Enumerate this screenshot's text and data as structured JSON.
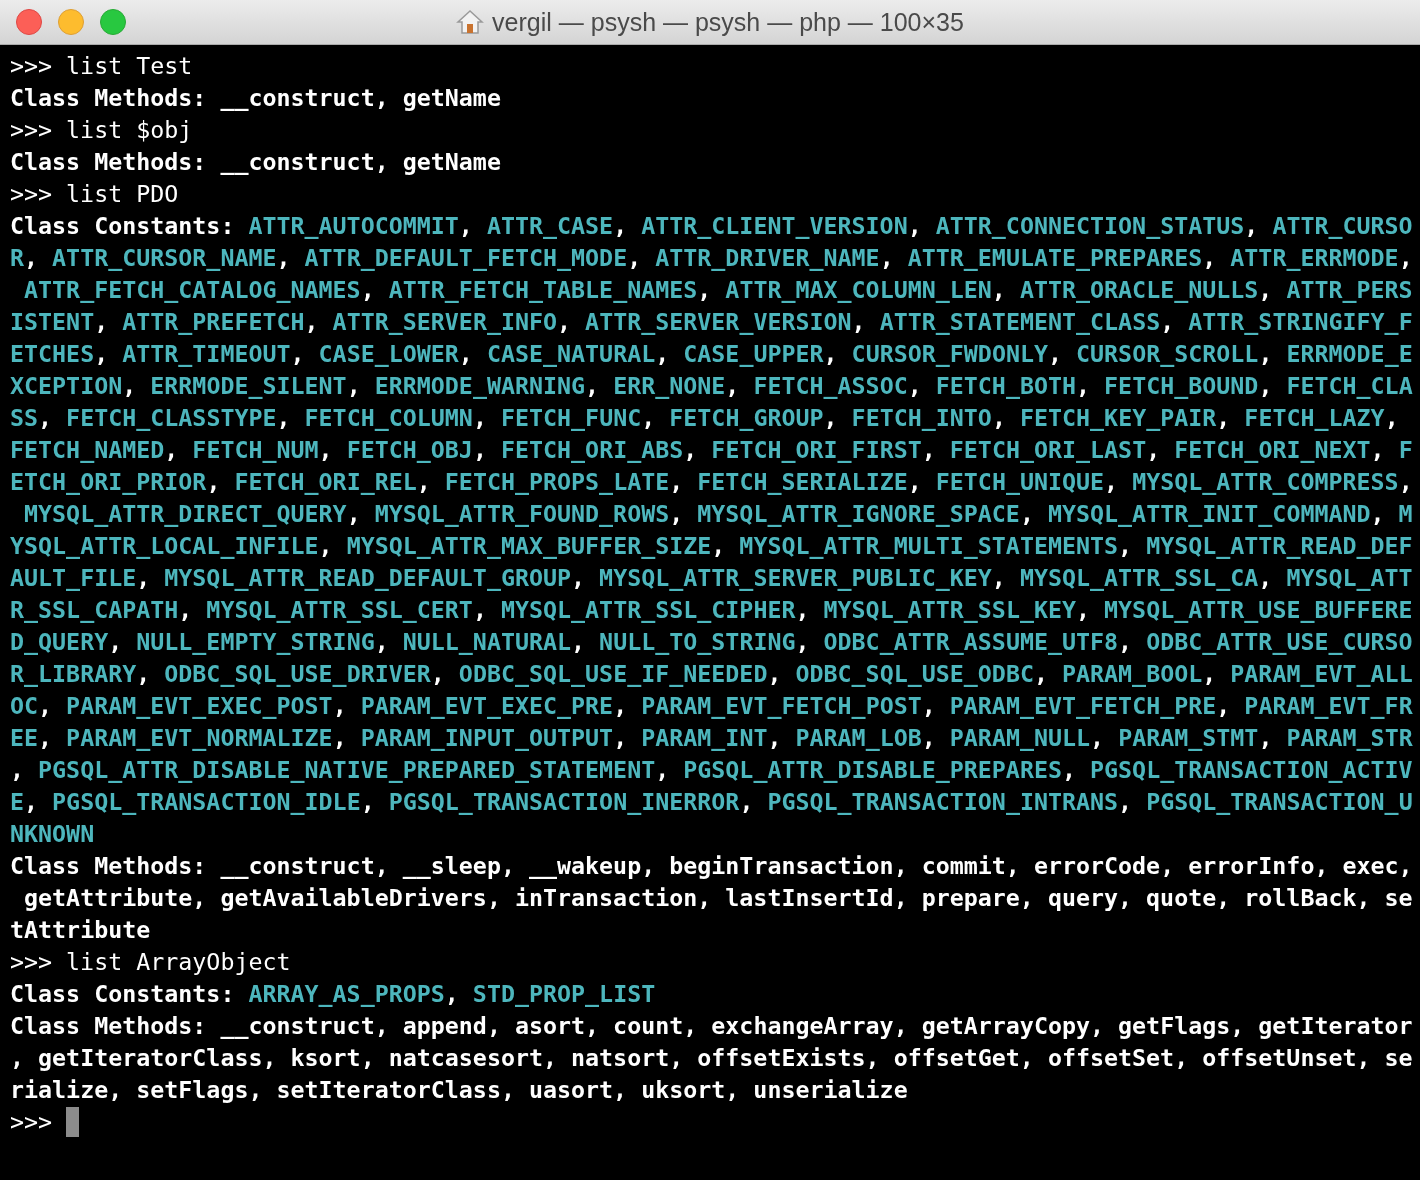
{
  "window": {
    "title": "vergil — psysh — psysh — php — 100×35"
  },
  "lines": [
    {
      "kind": "command",
      "prompt": ">>>",
      "text": "list Test"
    },
    {
      "kind": "methods",
      "label": "Class Methods:",
      "text": "__construct, getName"
    },
    {
      "kind": "command",
      "prompt": ">>>",
      "text": "list $obj"
    },
    {
      "kind": "methods",
      "label": "Class Methods:",
      "text": "__construct, getName"
    },
    {
      "kind": "command",
      "prompt": ">>>",
      "text": "list PDO"
    },
    {
      "kind": "constants",
      "label": "Class Constants:",
      "text": "ATTR_AUTOCOMMIT, ATTR_CASE, ATTR_CLIENT_VERSION, ATTR_CONNECTION_STATUS, ATTR_CURSO"
    },
    {
      "kind": "constants",
      "text": "R, ATTR_CURSOR_NAME, ATTR_DEFAULT_FETCH_MODE, ATTR_DRIVER_NAME, ATTR_EMULATE_PREPARES, ATTR_ERRMODE,"
    },
    {
      "kind": "constants",
      "text": " ATTR_FETCH_CATALOG_NAMES, ATTR_FETCH_TABLE_NAMES, ATTR_MAX_COLUMN_LEN, ATTR_ORACLE_NULLS, ATTR_PERS"
    },
    {
      "kind": "constants",
      "text": "ISTENT, ATTR_PREFETCH, ATTR_SERVER_INFO, ATTR_SERVER_VERSION, ATTR_STATEMENT_CLASS, ATTR_STRINGIFY_F"
    },
    {
      "kind": "constants",
      "text": "ETCHES, ATTR_TIMEOUT, CASE_LOWER, CASE_NATURAL, CASE_UPPER, CURSOR_FWDONLY, CURSOR_SCROLL, ERRMODE_E"
    },
    {
      "kind": "constants",
      "text": "XCEPTION, ERRMODE_SILENT, ERRMODE_WARNING, ERR_NONE, FETCH_ASSOC, FETCH_BOTH, FETCH_BOUND, FETCH_CLA"
    },
    {
      "kind": "constants",
      "text": "SS, FETCH_CLASSTYPE, FETCH_COLUMN, FETCH_FUNC, FETCH_GROUP, FETCH_INTO, FETCH_KEY_PAIR, FETCH_LAZY,"
    },
    {
      "kind": "constants",
      "text": "FETCH_NAMED, FETCH_NUM, FETCH_OBJ, FETCH_ORI_ABS, FETCH_ORI_FIRST, FETCH_ORI_LAST, FETCH_ORI_NEXT, F"
    },
    {
      "kind": "constants",
      "text": "ETCH_ORI_PRIOR, FETCH_ORI_REL, FETCH_PROPS_LATE, FETCH_SERIALIZE, FETCH_UNIQUE, MYSQL_ATTR_COMPRESS,"
    },
    {
      "kind": "constants",
      "text": " MYSQL_ATTR_DIRECT_QUERY, MYSQL_ATTR_FOUND_ROWS, MYSQL_ATTR_IGNORE_SPACE, MYSQL_ATTR_INIT_COMMAND, M"
    },
    {
      "kind": "constants",
      "text": "YSQL_ATTR_LOCAL_INFILE, MYSQL_ATTR_MAX_BUFFER_SIZE, MYSQL_ATTR_MULTI_STATEMENTS, MYSQL_ATTR_READ_DEF"
    },
    {
      "kind": "constants",
      "text": "AULT_FILE, MYSQL_ATTR_READ_DEFAULT_GROUP, MYSQL_ATTR_SERVER_PUBLIC_KEY, MYSQL_ATTR_SSL_CA, MYSQL_ATT"
    },
    {
      "kind": "constants",
      "text": "R_SSL_CAPATH, MYSQL_ATTR_SSL_CERT, MYSQL_ATTR_SSL_CIPHER, MYSQL_ATTR_SSL_KEY, MYSQL_ATTR_USE_BUFFERE"
    },
    {
      "kind": "constants",
      "text": "D_QUERY, NULL_EMPTY_STRING, NULL_NATURAL, NULL_TO_STRING, ODBC_ATTR_ASSUME_UTF8, ODBC_ATTR_USE_CURSO"
    },
    {
      "kind": "constants",
      "text": "R_LIBRARY, ODBC_SQL_USE_DRIVER, ODBC_SQL_USE_IF_NEEDED, ODBC_SQL_USE_ODBC, PARAM_BOOL, PARAM_EVT_ALL"
    },
    {
      "kind": "constants",
      "text": "OC, PARAM_EVT_EXEC_POST, PARAM_EVT_EXEC_PRE, PARAM_EVT_FETCH_POST, PARAM_EVT_FETCH_PRE, PARAM_EVT_FR"
    },
    {
      "kind": "constants",
      "text": "EE, PARAM_EVT_NORMALIZE, PARAM_INPUT_OUTPUT, PARAM_INT, PARAM_LOB, PARAM_NULL, PARAM_STMT, PARAM_STR"
    },
    {
      "kind": "constants",
      "text": ", PGSQL_ATTR_DISABLE_NATIVE_PREPARED_STATEMENT, PGSQL_ATTR_DISABLE_PREPARES, PGSQL_TRANSACTION_ACTIV"
    },
    {
      "kind": "constants",
      "text": "E, PGSQL_TRANSACTION_IDLE, PGSQL_TRANSACTION_INERROR, PGSQL_TRANSACTION_INTRANS, PGSQL_TRANSACTION_U"
    },
    {
      "kind": "constants",
      "text": "NKNOWN"
    },
    {
      "kind": "methods",
      "label": "Class Methods:",
      "text": "__construct, __sleep, __wakeup, beginTransaction, commit, errorCode, errorInfo, exec,"
    },
    {
      "kind": "methods",
      "text": " getAttribute, getAvailableDrivers, inTransaction, lastInsertId, prepare, query, quote, rollBack, se"
    },
    {
      "kind": "methods",
      "text": "tAttribute"
    },
    {
      "kind": "command",
      "prompt": ">>>",
      "text": "list ArrayObject"
    },
    {
      "kind": "constants",
      "label": "Class Constants:",
      "text": "ARRAY_AS_PROPS, STD_PROP_LIST"
    },
    {
      "kind": "methods",
      "label": "Class Methods:",
      "text": "__construct, append, asort, count, exchangeArray, getArrayCopy, getFlags, getIterator"
    },
    {
      "kind": "methods",
      "text": ", getIteratorClass, ksort, natcasesort, natsort, offsetExists, offsetGet, offsetSet, offsetUnset, se"
    },
    {
      "kind": "methods",
      "text": "rialize, setFlags, setIteratorClass, uasort, uksort, unserialize"
    },
    {
      "kind": "cursor",
      "prompt": ">>>"
    }
  ]
}
